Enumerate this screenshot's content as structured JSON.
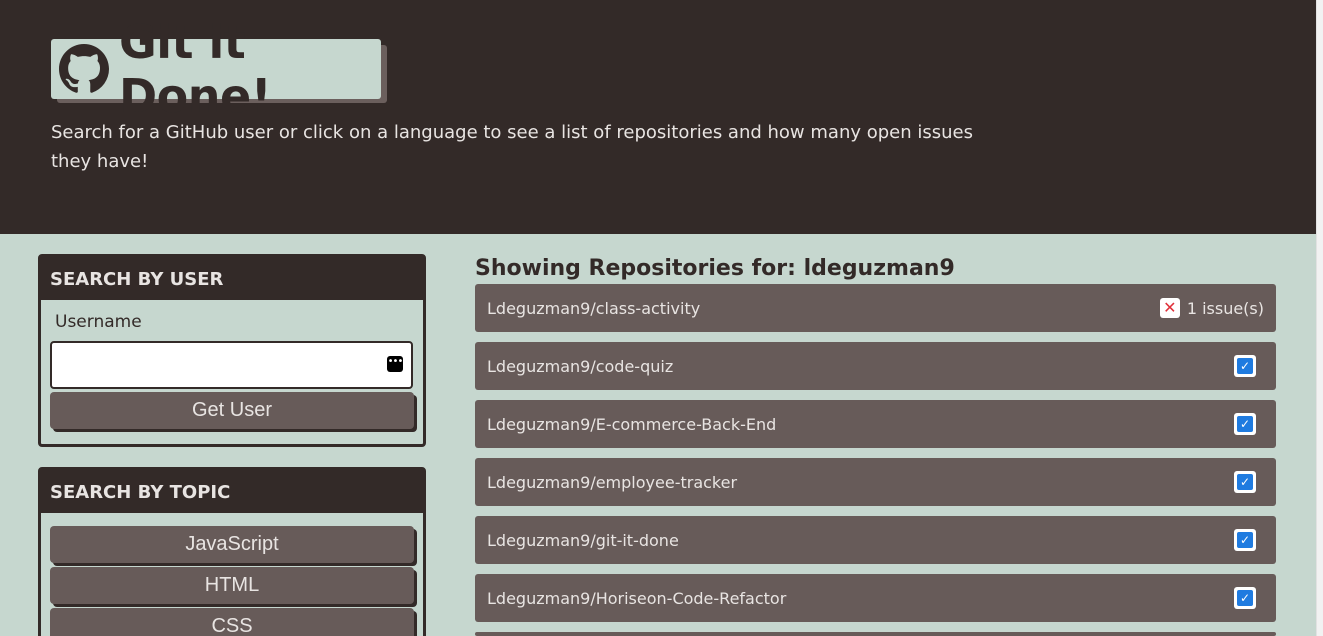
{
  "header": {
    "title": "Git it Done!",
    "subtitle": "Search for a GitHub user or click on a language to see a list of repositories and how many open issues they have!",
    "logo_icon": "github-icon"
  },
  "user_search": {
    "heading": "SEARCH BY USER",
    "label": "Username",
    "input_value": "",
    "button_label": "Get User"
  },
  "topic_search": {
    "heading": "SEARCH BY TOPIC",
    "buttons": [
      "JavaScript",
      "HTML",
      "CSS"
    ]
  },
  "results": {
    "heading": "Showing Repositories for: ldeguzman9",
    "repos": [
      {
        "name": "Ldeguzman9/class-activity",
        "status": "issues",
        "issues_text": "1 issue(s)"
      },
      {
        "name": "Ldeguzman9/code-quiz",
        "status": "ok"
      },
      {
        "name": "Ldeguzman9/E-commerce-Back-End",
        "status": "ok"
      },
      {
        "name": "Ldeguzman9/employee-tracker",
        "status": "ok"
      },
      {
        "name": "Ldeguzman9/git-it-done",
        "status": "ok"
      },
      {
        "name": "Ldeguzman9/Horiseon-Code-Refactor",
        "status": "ok"
      }
    ]
  },
  "colors": {
    "dark": "#332a28",
    "panel_bg": "#c6d7cf",
    "row_bg": "#675b59",
    "check_blue": "#1f7be0",
    "x_red": "#e0303a"
  }
}
